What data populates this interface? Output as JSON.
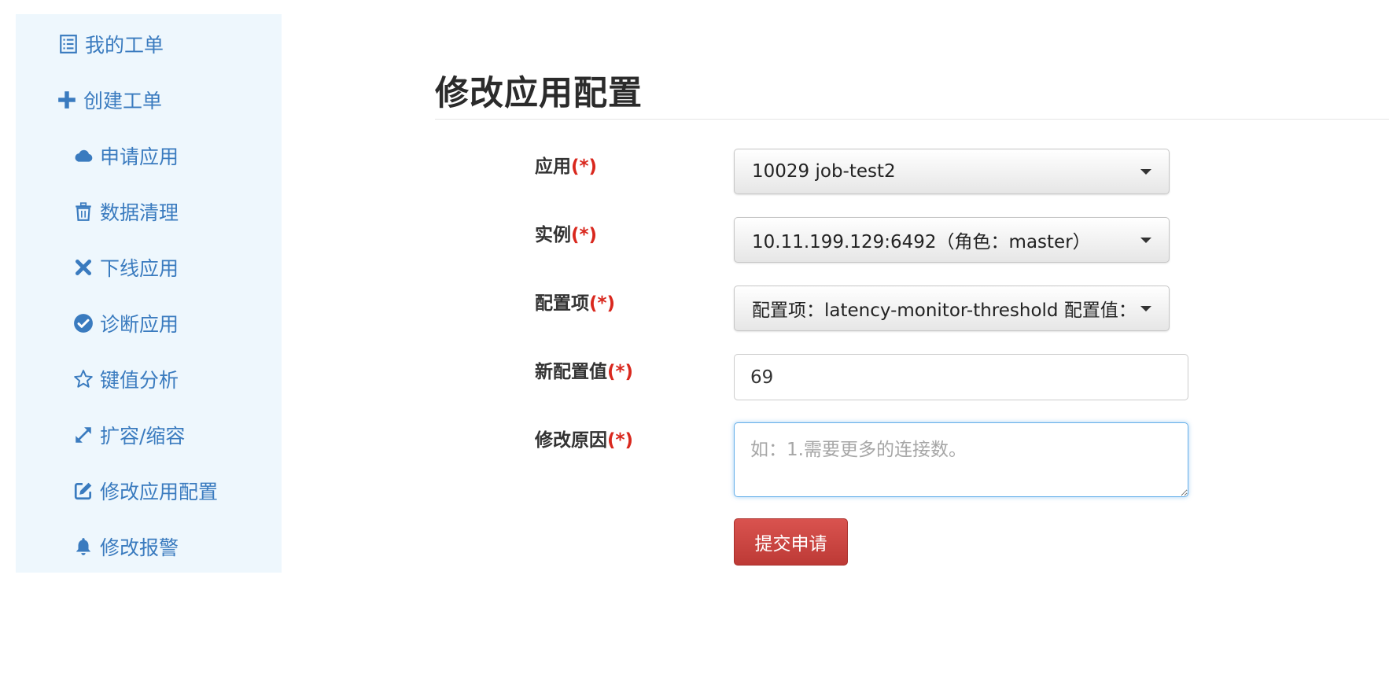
{
  "sidebar": {
    "items": [
      {
        "label": "我的工单",
        "icon": "list-icon"
      },
      {
        "label": "创建工单",
        "icon": "plus-icon"
      },
      {
        "label": "申请应用",
        "icon": "cloud-icon"
      },
      {
        "label": "数据清理",
        "icon": "trash-icon"
      },
      {
        "label": "下线应用",
        "icon": "close-icon"
      },
      {
        "label": "诊断应用",
        "icon": "check-circle-icon"
      },
      {
        "label": "键值分析",
        "icon": "star-icon"
      },
      {
        "label": "扩容/缩容",
        "icon": "resize-icon"
      },
      {
        "label": "修改应用配置",
        "icon": "edit-icon"
      },
      {
        "label": "修改报警",
        "icon": "bell-icon"
      }
    ]
  },
  "page": {
    "title": "修改应用配置"
  },
  "form": {
    "required_mark": "(*)",
    "app": {
      "label": "应用",
      "value": "10029 job-test2"
    },
    "instance": {
      "label": "实例",
      "value": "10.11.199.129:6492（角色：master）"
    },
    "config_item": {
      "label": "配置项",
      "value": "配置项：latency-monitor-threshold 配置值："
    },
    "new_value": {
      "label": "新配置值",
      "value": "69"
    },
    "reason": {
      "label": "修改原因",
      "placeholder": "如：1.需要更多的连接数。"
    },
    "submit_label": "提交申请"
  },
  "colors": {
    "sidebar_bg": "#eef7fd",
    "link": "#3a7bbf",
    "required": "#d9281e",
    "danger_button": "#c9302c"
  }
}
